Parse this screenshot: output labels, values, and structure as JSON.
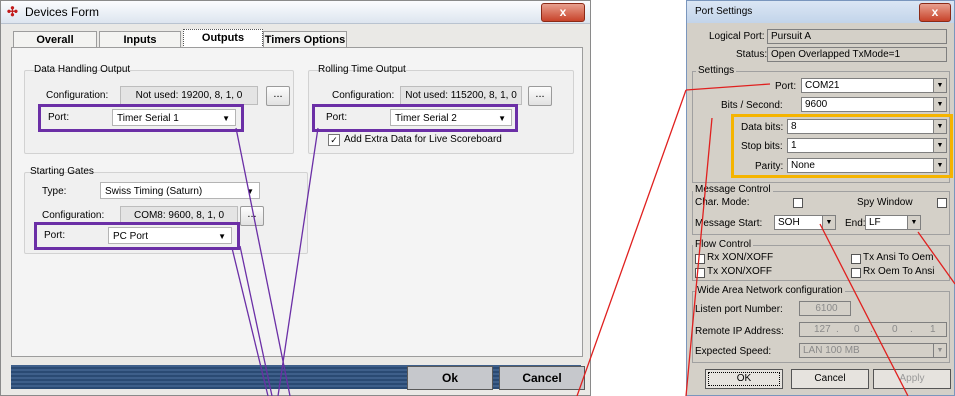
{
  "devices": {
    "title": "Devices Form",
    "close": "x",
    "tabs": [
      "Overall",
      "Inputs",
      "Outputs",
      "Timers Options"
    ],
    "data_handling": {
      "legend": "Data Handling Output",
      "config_label": "Configuration:",
      "config_value": "Not used: 19200, 8, 1, 0",
      "dots": "...",
      "port_label": "Port:",
      "port_value": "Timer Serial 1"
    },
    "rolling": {
      "legend": "Rolling Time Output",
      "config_label": "Configuration:",
      "config_value": "Not used: 115200, 8, 1, 0",
      "dots": "...",
      "port_label": "Port:",
      "port_value": "Timer Serial 2",
      "extra_label": "Add Extra Data for Live Scoreboard",
      "extra_checked": true
    },
    "gates": {
      "legend": "Starting Gates",
      "type_label": "Type:",
      "type_value": "Swiss Timing (Saturn)",
      "config_label": "Configuration:",
      "config_value": "COM8: 9600, 8, 1, 0",
      "dots": "...",
      "port_label": "Port:",
      "port_value": "PC Port"
    },
    "ok": "Ok",
    "cancel": "Cancel"
  },
  "port_settings": {
    "title": "Port Settings",
    "close": "x",
    "logical_port_label": "Logical Port:",
    "logical_port_value": "Pursuit A",
    "status_label": "Status:",
    "status_value": "Open Overlapped TxMode=1",
    "settings_legend": "Settings",
    "port_label": "Port:",
    "port_value": "COM21",
    "bits_label": "Bits / Second:",
    "bits_value": "9600",
    "data_bits_label": "Data bits:",
    "data_bits_value": "8",
    "stop_bits_label": "Stop bits:",
    "stop_bits_value": "1",
    "parity_label": "Parity:",
    "parity_value": "None",
    "msg_legend": "Message Control",
    "char_mode": "Char. Mode:",
    "spy_window": "Spy Window",
    "msg_start_label": "Message Start:",
    "msg_start_value": "SOH",
    "end_label": "End:",
    "end_value": "LF",
    "flow_legend": "Flow Control",
    "rx_xon": "Rx XON/XOFF",
    "tx_ansi": "Tx Ansi To Oem",
    "tx_xon": "Tx XON/XOFF",
    "rx_oem": "Rx Oem To Ansi",
    "wan_legend": "Wide Area Network configuration",
    "listen_label": "Listen port Number:",
    "listen_value": "6100",
    "remote_label": "Remote IP Address:",
    "ip": [
      "127",
      "0",
      "0",
      "1"
    ],
    "speed_label": "Expected Speed:",
    "speed_value": "LAN 100 MB",
    "ok": "OK",
    "cancel": "Cancel",
    "apply": "Apply"
  },
  "colors": {
    "highlight_purple": "#6b2fa6",
    "highlight_orange": "#f5b400",
    "annotation_red": "#e0201f"
  }
}
